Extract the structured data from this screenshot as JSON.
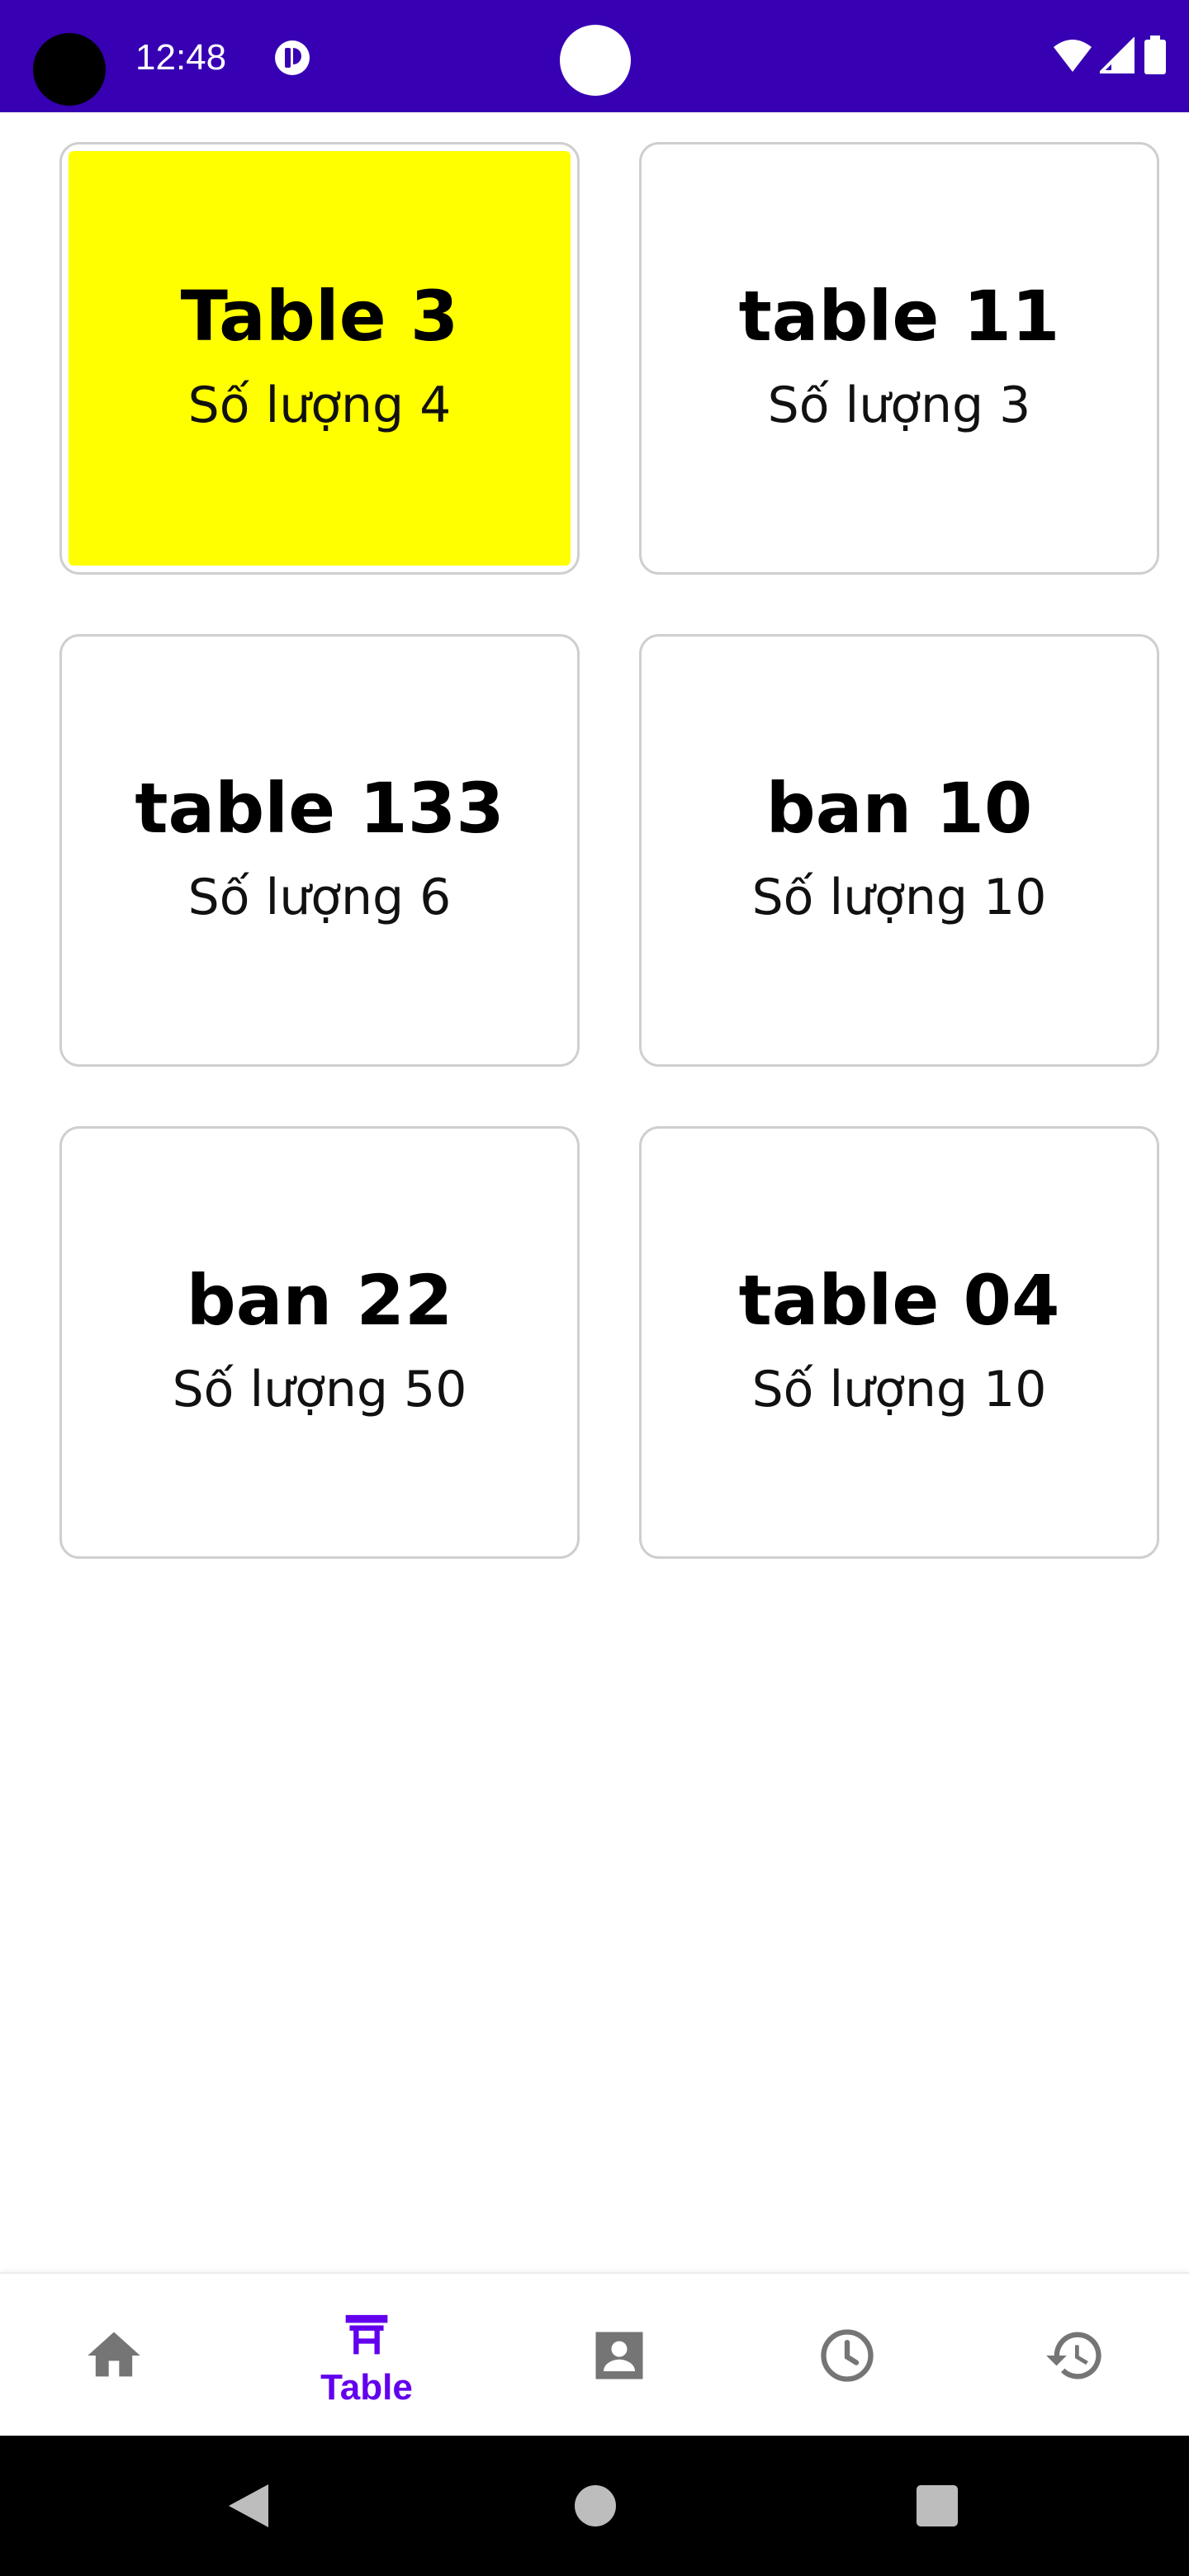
{
  "status_bar": {
    "time": "12:48",
    "background": "#3700b3"
  },
  "tables": [
    {
      "name": "Table 3",
      "quantity": "Số lượng 4",
      "selected": true
    },
    {
      "name": "table 11",
      "quantity": "Số lượng 3",
      "selected": false
    },
    {
      "name": "table 133",
      "quantity": "Số lượng 6",
      "selected": false
    },
    {
      "name": "ban 10",
      "quantity": "Số lượng 10",
      "selected": false
    },
    {
      "name": "ban 22",
      "quantity": "Số lượng 50",
      "selected": false
    },
    {
      "name": "table 04",
      "quantity": "Số lượng 10",
      "selected": false
    }
  ],
  "colors": {
    "selected_card": "#ffff00",
    "nav_active": "#6200ee",
    "nav_inactive": "#757575"
  },
  "bottom_nav": {
    "items": [
      {
        "icon": "home-icon",
        "label": "",
        "active": false
      },
      {
        "icon": "table-icon",
        "label": "Table",
        "active": true
      },
      {
        "icon": "contact-card-icon",
        "label": "",
        "active": false
      },
      {
        "icon": "clock-icon",
        "label": "",
        "active": false
      },
      {
        "icon": "history-icon",
        "label": "",
        "active": false
      }
    ]
  },
  "system_nav": {
    "buttons": [
      "back-icon",
      "home-circle-icon",
      "recents-icon"
    ]
  }
}
